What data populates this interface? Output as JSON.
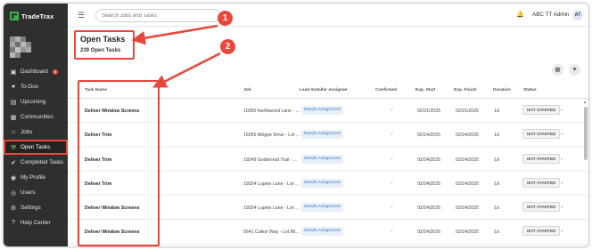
{
  "brand": {
    "name": "TradeTrax"
  },
  "nav": [
    {
      "label": "Dashboard",
      "icon": "dashboard-icon",
      "badge": "5",
      "active": false
    },
    {
      "label": "To-Dos",
      "icon": "todo-icon",
      "active": false
    },
    {
      "label": "Upcoming",
      "icon": "calendar-icon",
      "active": false
    },
    {
      "label": "Communities",
      "icon": "communities-icon",
      "active": false
    },
    {
      "label": "Jobs",
      "icon": "home-icon",
      "active": false
    },
    {
      "label": "Open Tasks",
      "icon": "wrench-icon",
      "active": true
    },
    {
      "label": "Completed Tasks",
      "icon": "check-circle-icon",
      "active": false
    },
    {
      "label": "My Profile",
      "icon": "user-icon",
      "active": false
    },
    {
      "label": "Users",
      "icon": "users-icon",
      "active": false
    },
    {
      "label": "Settings",
      "icon": "gear-icon",
      "active": false
    },
    {
      "label": "Help Center",
      "icon": "help-icon",
      "active": false
    }
  ],
  "topbar": {
    "search_placeholder": "Search Jobs and Tasks",
    "account": "ABC TT Admin",
    "avatar": "AT"
  },
  "page": {
    "title": "Open Tasks",
    "count": "239 Open Tasks"
  },
  "table": {
    "headers": {
      "task": "Task Name",
      "job": "Job",
      "installer": "Lead Installer Assignee",
      "confirmed": "Confirmed",
      "start": "Exp. Start",
      "finish": "Exp. Finish",
      "duration": "Duration",
      "status": "Status"
    },
    "rows": [
      {
        "task": "Deliver Window Screens",
        "job": "10355 Northwood Lane - ...",
        "installer": "Needs Assignment",
        "start": "02/21/2025",
        "finish": "02/21/2025",
        "duration": "1d",
        "status": "NOT STARTED"
      },
      {
        "task": "Deliver Trim",
        "job": "15055 Athgoe Drive - Lot ...",
        "installer": "Needs Assignment",
        "start": "02/24/2025",
        "finish": "02/24/2025",
        "duration": "1d",
        "status": "NOT STARTED"
      },
      {
        "task": "Deliver Trim",
        "job": "19249 Goldenrod Trail - ...",
        "installer": "Needs Assignment",
        "start": "02/24/2025",
        "finish": "02/24/2025",
        "duration": "1d",
        "status": "NOT STARTED"
      },
      {
        "task": "Deliver Trim",
        "job": "19324 Lupine Lane - Lot ...",
        "installer": "Needs Assignment",
        "start": "02/24/2025",
        "finish": "02/24/2025",
        "duration": "1d",
        "status": "NOT STARTED"
      },
      {
        "task": "Deliver Window Screens",
        "job": "19324 Lupine Lane - Lot ...",
        "installer": "Needs Assignment",
        "start": "02/24/2025",
        "finish": "02/24/2025",
        "duration": "1d",
        "status": "NOT STARTED"
      },
      {
        "task": "Deliver Window Screens",
        "job": "5641 Catkin Way - Lot 86...",
        "installer": "Needs Assignment",
        "start": "02/24/2025",
        "finish": "02/24/2025",
        "duration": "1d",
        "status": "NOT STARTED"
      }
    ]
  },
  "annotations": {
    "callout_1": "1",
    "callout_2": "2",
    "color": "#e8473a"
  }
}
